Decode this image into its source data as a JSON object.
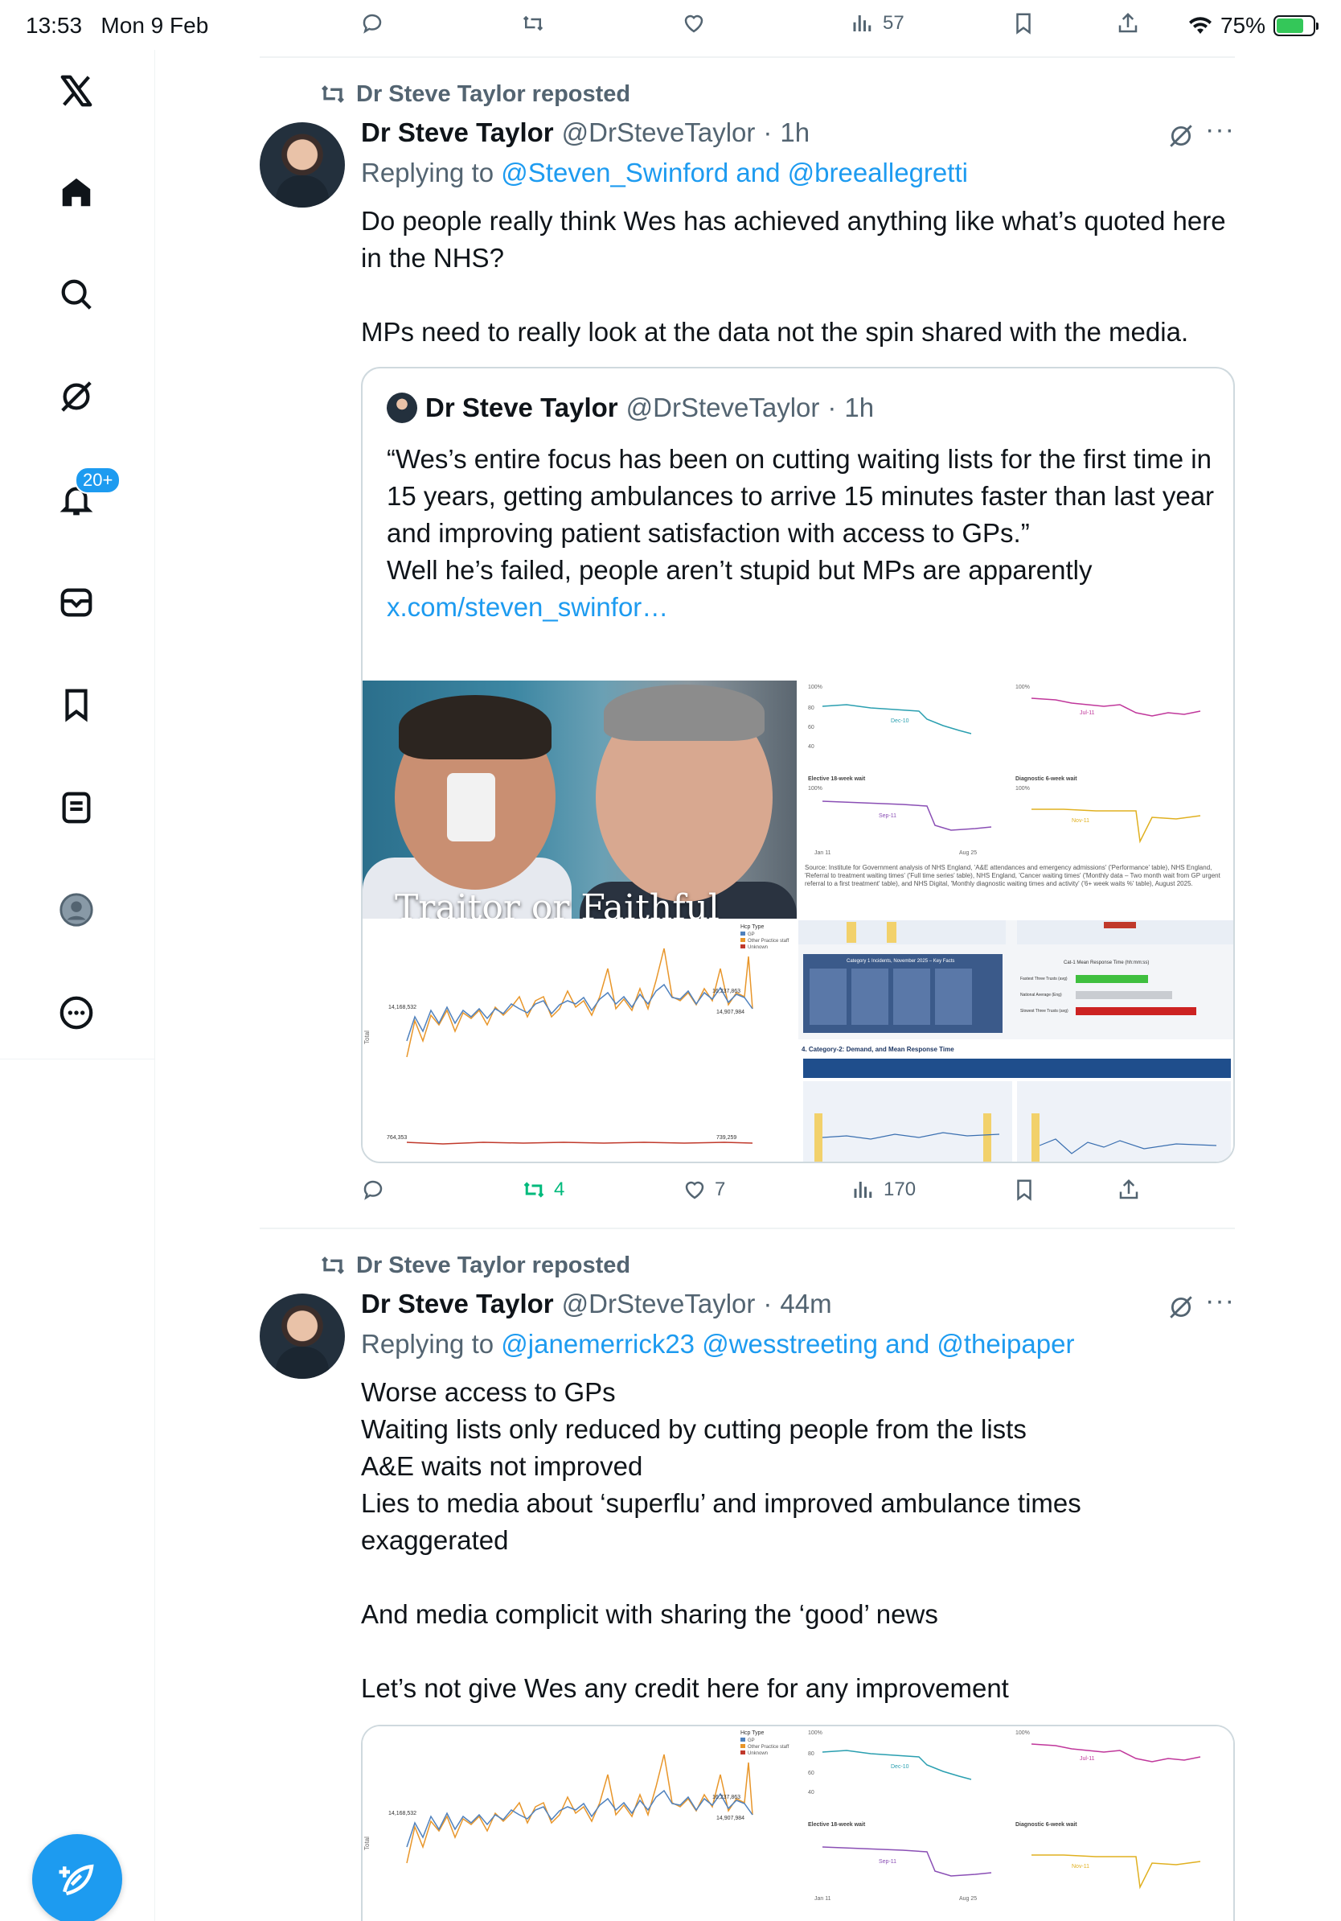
{
  "status_bar": {
    "time": "13:53",
    "date": "Mon 9 Feb",
    "battery": "75%",
    "battery_level": 0.75
  },
  "previous_tweet_actions": {
    "views": "57"
  },
  "sidebar": {
    "items": [
      {
        "name": "x-logo-icon"
      },
      {
        "name": "home-icon"
      },
      {
        "name": "search-icon"
      },
      {
        "name": "grok-icon"
      },
      {
        "name": "notifications-icon"
      },
      {
        "name": "messages-icon"
      },
      {
        "name": "bookmarks-icon"
      },
      {
        "name": "lists-icon"
      },
      {
        "name": "profile-icon"
      },
      {
        "name": "more-icon"
      }
    ],
    "notification_badge": "20+"
  },
  "tweets": [
    {
      "repost_label": "Dr Steve Taylor reposted",
      "name": "Dr Steve Taylor",
      "handle": "@DrSteveTaylor",
      "time": "1h",
      "replying_prefix": "Replying to",
      "replying_to": "@Steven_Swinford and @breeallegretti",
      "body": [
        "Do people really think Wes has achieved anything like what’s quoted here in the NHS?",
        "MPs need to really look at the data not the spin shared with the media."
      ],
      "quote": {
        "name": "Dr Steve Taylor",
        "handle": "@DrSteveTaylor",
        "time": "1h",
        "text": "“Wes’s entire focus has been on cutting waiting lists for the first time in 15 years, getting ambulances to arrive 15 minutes faster than last year and improving patient satisfaction with access to GPs.”\nWell he’s failed, people aren’t stupid but MPs are apparently",
        "link": "x.com/steven_swinfor…",
        "photo_caption": "Traitor or Faithful"
      },
      "actions": {
        "reposts": "4",
        "likes": "7",
        "views": "170"
      }
    },
    {
      "repost_label": "Dr Steve Taylor reposted",
      "name": "Dr Steve Taylor",
      "handle": "@DrSteveTaylor",
      "time": "44m",
      "replying_prefix": "Replying to",
      "replying_to": "@janemerrick23 @wesstreeting and @theipaper",
      "body": [
        "Worse access to GPs\nWaiting lists only reduced by cutting people from the lists\nA&E waits not improved\nLies to media about ‘superflu’ and improved ambulance times exaggerated",
        "And media complicit with sharing the ‘good’ news",
        "Let’s not give Wes any credit here for any improvement"
      ]
    }
  ],
  "chart_data": [
    {
      "type": "line",
      "title": "",
      "legend_title": "Hcp Type",
      "series": [
        {
          "name": "GP",
          "color": "#4f81bd"
        },
        {
          "name": "Other Practice staff",
          "color": "#e8962a"
        },
        {
          "name": "Unknown",
          "color": "#c0392b"
        }
      ],
      "labels": [
        "14,168,532",
        "16,237,863",
        "14,907,984",
        "764,353",
        "739,259"
      ],
      "ylabel": "Total"
    },
    {
      "type": "line",
      "labels": [
        "Dec-10",
        "Jul-11",
        "Sep-11",
        "Nov-11",
        "Jan 11",
        "Aug 25"
      ],
      "panels": [
        "Elective 18-week wait",
        "Diagnostic 6-week wait"
      ],
      "yticks": [
        "100%",
        "80",
        "60",
        "40"
      ],
      "source_note": "Source: Institute for Government analysis of NHS England, 'A&E attendances and emergency admissions' ('Performance' table), NHS England, 'Referral to treatment waiting times' ('Full time series' table), NHS England, 'Cancer waiting times' ('Monthly data – Two month wait from GP urgent referral to a first treatment' table), and NHS Digital, 'Monthly diagnostic waiting times and activity' ('6+ week waits %' table), August 2025."
    },
    {
      "type": "table",
      "title": "Category 1 Incidents, November 2025 – Key Facts",
      "subtitle": "Cat-1 Mean Response Time (hh:mm:ss)",
      "section_title": "4. Category-2: Demand, and Mean Response Time",
      "rows": [
        "Fastest Three Trusts (avg)",
        "National Average (Eng)",
        "Slowest Three Trusts (avg)"
      ]
    }
  ]
}
